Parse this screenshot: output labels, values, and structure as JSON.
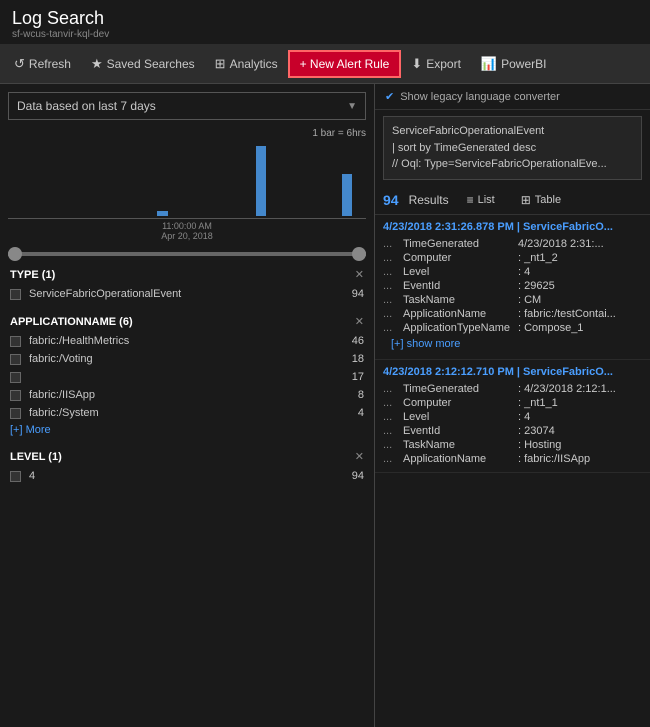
{
  "header": {
    "app_title": "Log Search",
    "app_subtitle": "sf-wcus-tanvir-kql-dev"
  },
  "toolbar": {
    "refresh_label": "Refresh",
    "saved_searches_label": "Saved Searches",
    "analytics_label": "Analytics",
    "new_alert_label": "+ New Alert Rule",
    "export_label": "Export",
    "powerbi_label": "PowerBI"
  },
  "left_panel": {
    "date_selector": {
      "text": "Data based on last 7 days"
    },
    "chart": {
      "legend": "1 bar = 6hrs",
      "x_label_line1": "11:00:00 AM",
      "x_label_line2": "Apr 20, 2018",
      "bars": [
        0,
        0,
        0,
        0,
        0,
        0,
        0,
        0,
        0,
        0,
        0,
        0,
        5,
        0,
        0,
        0,
        0,
        0,
        0,
        0,
        75,
        0,
        0,
        0,
        0,
        0,
        0,
        45,
        0
      ]
    },
    "filters": [
      {
        "id": "type",
        "title": "TYPE  (1)",
        "items": [
          {
            "label": "ServiceFabricOperationalEvent",
            "count": 94,
            "checked": false
          }
        ],
        "more": null
      },
      {
        "id": "appname",
        "title": "APPLICATIONNAME  (6)",
        "items": [
          {
            "label": "fabric:/HealthMetrics",
            "count": 46,
            "checked": false
          },
          {
            "label": "fabric:/Voting",
            "count": 18,
            "checked": false
          },
          {
            "label": "",
            "count": 17,
            "checked": false
          },
          {
            "label": "fabric:/IISApp",
            "count": 8,
            "checked": false
          },
          {
            "label": "fabric:/System",
            "count": 4,
            "checked": false
          }
        ],
        "more": "[+] More"
      },
      {
        "id": "level",
        "title": "LEVEL  (1)",
        "items": [
          {
            "label": "4",
            "count": 94,
            "checked": false
          }
        ],
        "more": null
      }
    ]
  },
  "right_panel": {
    "legacy_toggle": {
      "label": "Show legacy language converter",
      "checked": true
    },
    "query": "ServiceFabricOperationalEvent\n| sort by TimeGenerated desc\n// Oql: Type=ServiceFabricOperationalEve...",
    "results": {
      "count": 94,
      "count_label": "Results",
      "view_list": "List",
      "view_table": "Table"
    },
    "entries": [
      {
        "title": "4/23/2018 2:31:26.878 PM | ServiceFabricO...",
        "fields": [
          {
            "key": "TimeGenerated",
            "value": "4/23/2018 2:31:..."
          },
          {
            "key": "Computer",
            "value": ": _nt1_2"
          },
          {
            "key": "Level",
            "value": ": 4"
          },
          {
            "key": "EventId",
            "value": ": 29625"
          },
          {
            "key": "TaskName",
            "value": ": CM"
          },
          {
            "key": "ApplicationName",
            "value": ": fabric:/testContai..."
          },
          {
            "key": "ApplicationTypeName",
            "value": ": Compose_1"
          }
        ],
        "show_more": "[+] show more"
      },
      {
        "title": "4/23/2018 2:12:12.710 PM | ServiceFabricO...",
        "fields": [
          {
            "key": "TimeGenerated",
            "value": ": 4/23/2018 2:12:1..."
          },
          {
            "key": "Computer",
            "value": ": _nt1_1"
          },
          {
            "key": "Level",
            "value": ": 4"
          },
          {
            "key": "EventId",
            "value": ": 23074"
          },
          {
            "key": "TaskName",
            "value": ": Hosting"
          },
          {
            "key": "ApplicationName",
            "value": ": fabric:/IISApp"
          }
        ],
        "show_more": null
      }
    ]
  }
}
